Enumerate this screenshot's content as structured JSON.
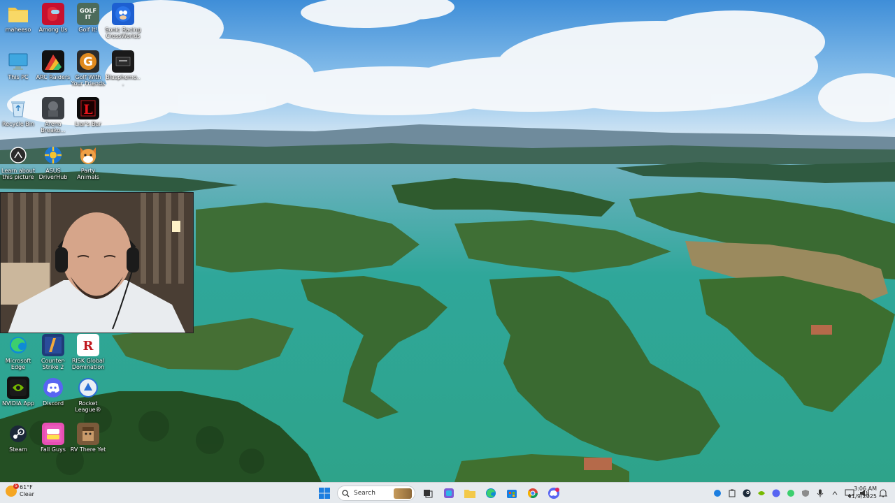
{
  "desktop": {
    "icons": [
      {
        "label": "maheeso",
        "icon": "folder-icon",
        "color": "#f3c94a"
      },
      {
        "label": "Among Us",
        "icon": "among-us-icon",
        "color": "#c8102e"
      },
      {
        "label": "Golf It!",
        "icon": "golf-it-icon",
        "color": "#4c6b5b"
      },
      {
        "label": "Sonic Racing CrossWorlds",
        "icon": "sonic-icon",
        "color": "#1d5fd1"
      },
      {
        "label": "This PC",
        "icon": "monitor-icon",
        "color": "#3fa7e0"
      },
      {
        "label": "ARC Raiders",
        "icon": "arc-raiders-icon",
        "color": "#111111"
      },
      {
        "label": "Golf With Your Friends",
        "icon": "golf-with-friends-icon",
        "color": "#e08a1e"
      },
      {
        "label": "Blasphemo...",
        "icon": "blasphemous-icon",
        "color": "#1a1a1a"
      },
      {
        "label": "Recycle Bin",
        "icon": "recycle-bin-icon",
        "color": "#7fb9e6"
      },
      {
        "label": "Arena Breako...",
        "icon": "arena-breakout-icon",
        "color": "#3b3f44"
      },
      {
        "label": "Liar's Bar",
        "icon": "liars-bar-icon",
        "color": "#0b0b0b"
      },
      {
        "label": "Learn about this picture",
        "icon": "learn-picture-icon",
        "color": "#2b2b2b"
      },
      {
        "label": "ASUS DriverHub",
        "icon": "asus-driverhub-icon",
        "color": "#1d76d2"
      },
      {
        "label": "Party Animals",
        "icon": "party-animals-icon",
        "color": "#e8913a"
      },
      {
        "label": "Microsoft Edge",
        "icon": "edge-icon",
        "color": "#0f8bd6"
      },
      {
        "label": "Counter-Strike 2",
        "icon": "counter-strike-icon",
        "color": "#1f3b78"
      },
      {
        "label": "RISK Global Domination",
        "icon": "risk-icon",
        "color": "#ffffff"
      },
      {
        "label": "NVIDIA App",
        "icon": "nvidia-icon",
        "color": "#111111"
      },
      {
        "label": "Discord",
        "icon": "discord-icon",
        "color": "#5865f2"
      },
      {
        "label": "Rocket League®",
        "icon": "rocket-league-icon",
        "color": "#2a6fd6"
      },
      {
        "label": "Steam",
        "icon": "steam-icon",
        "color": "#1b2838"
      },
      {
        "label": "Fall Guys",
        "icon": "fall-guys-icon",
        "color": "#e84fb4"
      },
      {
        "label": "RV There Yet",
        "icon": "rv-there-yet-icon",
        "color": "#7a5a3a"
      }
    ]
  },
  "taskbar": {
    "weather": {
      "temp": "61°F",
      "condition": "Clear",
      "badge": "5"
    },
    "search_placeholder": "Search",
    "pinned": [
      "start-icon",
      "search-icon",
      "task-view-icon",
      "copilot-icon",
      "file-explorer-icon",
      "edge-icon",
      "store-icon",
      "chrome-icon",
      "discord-icon"
    ],
    "clock": {
      "time": "3:06 AM",
      "date": "11/9/2025"
    }
  }
}
